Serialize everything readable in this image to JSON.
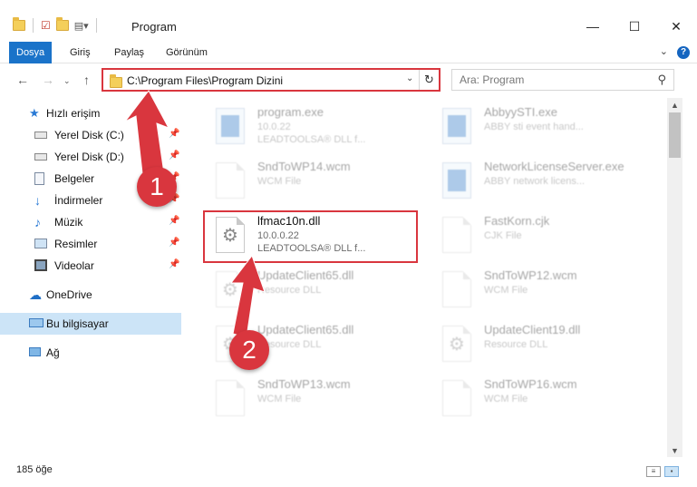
{
  "window": {
    "title": "Program",
    "controls": {
      "minimize": "—",
      "maximize": "☐",
      "close": "✕"
    }
  },
  "ribbon": {
    "tabs": [
      "Dosya",
      "Giriş",
      "Paylaş",
      "Görünüm"
    ],
    "help": "?"
  },
  "address_bar": {
    "path": "C:\\Program Files\\Program Dizini",
    "search_placeholder": "Ara: Program"
  },
  "sidebar": {
    "quick_access": "Hızlı erişim",
    "items": [
      {
        "label": "Yerel Disk (C:)",
        "icon": "drive-icon"
      },
      {
        "label": "Yerel Disk (D:)",
        "icon": "drive-icon"
      },
      {
        "label": "Belgeler",
        "icon": "documents-icon"
      },
      {
        "label": "İndirmeler",
        "icon": "downloads-icon"
      },
      {
        "label": "Müzik",
        "icon": "music-icon"
      },
      {
        "label": "Resimler",
        "icon": "pictures-icon"
      },
      {
        "label": "Videolar",
        "icon": "videos-icon"
      }
    ],
    "onedrive": "OneDrive",
    "this_pc": "Bu bilgisayar",
    "network": "Ağ"
  },
  "files": [
    {
      "name": "program.exe",
      "line1": "10.0.22",
      "line2": "LEADTOOLSA® DLL f...",
      "icon": "program-icon",
      "faded": true
    },
    {
      "name": "AbbyySTI.exe",
      "line1": "ABBY sti event hand...",
      "line2": "",
      "icon": "app-icon",
      "faded": true
    },
    {
      "name": "SndToWP14.wcm",
      "line1": "WCM File",
      "line2": "",
      "icon": "file-icon",
      "faded": true
    },
    {
      "name": "NetworkLicenseServer.exe",
      "line1": "ABBY network licens...",
      "line2": "",
      "icon": "app-icon",
      "faded": true
    },
    {
      "name": "lfmac10n.dll",
      "line1": "10.0.0.22",
      "line2": "LEADTOOLSA® DLL f...",
      "icon": "dll-gear-icon",
      "faded": false
    },
    {
      "name": "FastKorn.cjk",
      "line1": "CJK File",
      "line2": "",
      "icon": "file-icon",
      "faded": true
    },
    {
      "name": "UpdateClient65.dll",
      "line1": "Resource DLL",
      "line2": "",
      "icon": "dll-gear-icon",
      "faded": true
    },
    {
      "name": "SndToWP12.wcm",
      "line1": "WCM File",
      "line2": "",
      "icon": "file-icon",
      "faded": true
    },
    {
      "name": "UpdateClient65.dll",
      "line1": "Resource DLL",
      "line2": "",
      "icon": "dll-gear-icon",
      "faded": true
    },
    {
      "name": "UpdateClient19.dll",
      "line1": "Resource DLL",
      "line2": "",
      "icon": "dll-gear-icon",
      "faded": true
    },
    {
      "name": "SndToWP13.wcm",
      "line1": "WCM File",
      "line2": "",
      "icon": "file-icon",
      "faded": true
    },
    {
      "name": "SndToWP16.wcm",
      "line1": "WCM File",
      "line2": "",
      "icon": "file-icon",
      "faded": true
    }
  ],
  "status": {
    "item_count": "185 öğe"
  },
  "annotations": {
    "step1": "1",
    "step2": "2"
  },
  "colors": {
    "accent": "#1a73c9",
    "highlight": "#d9363e",
    "selection": "#cce4f7"
  }
}
